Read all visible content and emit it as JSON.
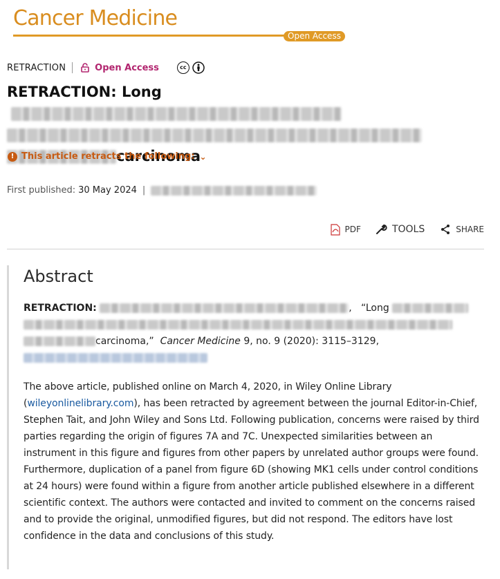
{
  "journal": {
    "name": "Cancer Medicine",
    "badge": "Open Access"
  },
  "meta": {
    "article_type": "RETRACTION",
    "access_label": "Open Access",
    "license_icons": [
      "cc-icon",
      "by-icon"
    ]
  },
  "article": {
    "title_start": "RETRACTION: Long",
    "title_end": "carcinoma",
    "retracts_label": "This article retracts the following:",
    "first_published_label": "First published:",
    "first_published_date": "30 May 2024",
    "separator": "|"
  },
  "tools": {
    "pdf": "PDF",
    "tools": "TOOLS",
    "share": "SHARE"
  },
  "abstract": {
    "heading": "Abstract",
    "citation_label": "RETRACTION:",
    "citation_title_start": "“Long",
    "citation_title_end": "carcinoma,”",
    "citation_journal": "Cancer Medicine",
    "citation_rest": "9, no. 9 (2020): 3115–3129,",
    "body_before_link": "The above article, published online on March 4, 2020, in Wiley Online Library (",
    "body_link": "wileyonlinelibrary.com",
    "body_after_link": "), has been retracted by agreement between the journal Editor-in-Chief, Stephen Tait, and John Wiley and Sons Ltd. Following publication, concerns were raised by third parties regarding the origin of figures 7A and 7C. Unexpected similarities between an instrument in this figure and figures from other papers by unrelated author groups were found. Furthermore, duplication of a panel from figure 6D (showing MK1 cells under control conditions at 24 hours) were found within a figure from another article published elsewhere in a different scientific context. The authors were contacted and invited to comment on the concerns raised and to provide the original, unmodified figures, but did not respond. The editors have lost confidence in the data and conclusions of this study."
  },
  "colors": {
    "brand_orange": "#e09a26",
    "open_access_magenta": "#b2256f",
    "warning_orange": "#c75b12",
    "link_blue": "#1a5aa0"
  }
}
